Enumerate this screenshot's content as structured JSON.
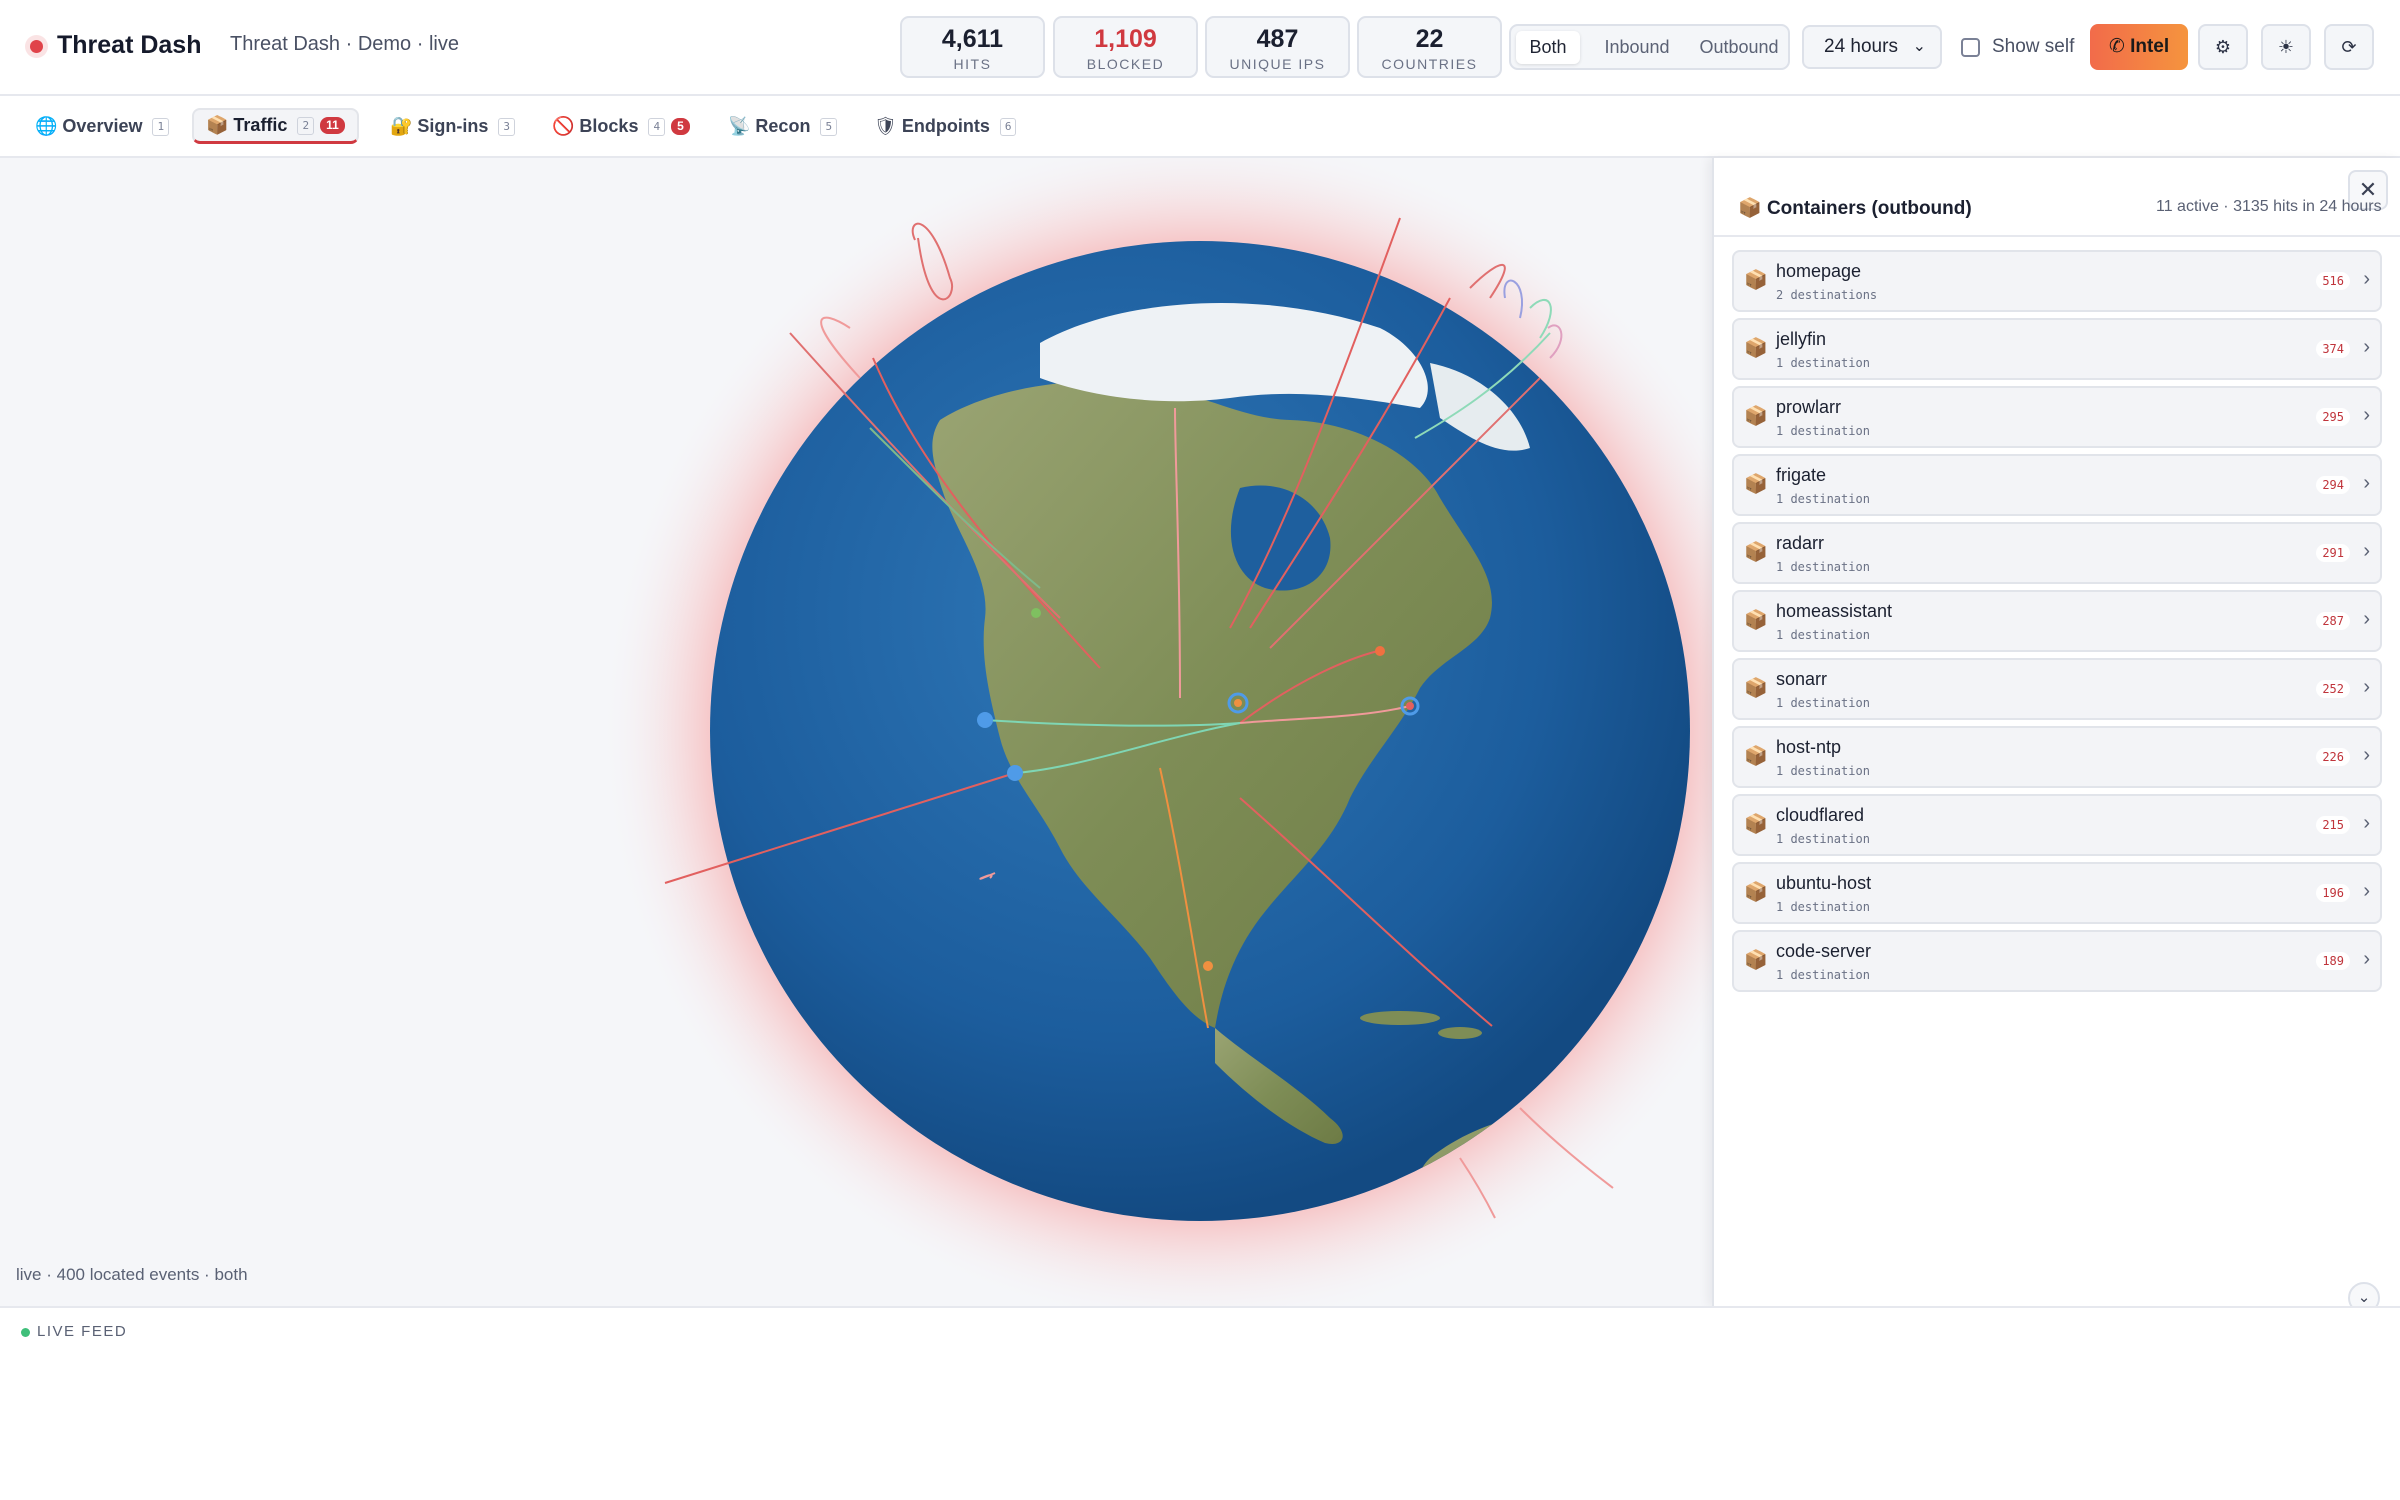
{
  "header": {
    "title": "Threat Dash",
    "subtitle": "Threat Dash · Demo · live"
  },
  "stats": [
    {
      "value": "4,611",
      "label": "HITS"
    },
    {
      "value": "1,109",
      "label": "BLOCKED"
    },
    {
      "value": "487",
      "label": "UNIQUE IPS"
    },
    {
      "value": "22",
      "label": "COUNTRIES"
    }
  ],
  "direction": {
    "options": [
      "Both",
      "Inbound",
      "Outbound"
    ],
    "selected": "Both"
  },
  "time_range": {
    "value": "24 hours"
  },
  "show_self": {
    "label": "Show self",
    "checked": false
  },
  "intel": {
    "label": "Intel"
  },
  "header_icons": [
    "gear-icon",
    "sun-icon",
    "refresh-icon"
  ],
  "tabs": [
    {
      "icon": "🌐",
      "label": "Overview",
      "key": "1",
      "badge": ""
    },
    {
      "icon": "📦",
      "label": "Traffic",
      "key": "2",
      "badge": "11"
    },
    {
      "icon": "🔐",
      "label": "Sign-ins",
      "key": "3",
      "badge": ""
    },
    {
      "icon": "🚫",
      "label": "Blocks",
      "key": "4",
      "badge": "5"
    },
    {
      "icon": "📡",
      "label": "Recon",
      "key": "5",
      "badge": ""
    },
    {
      "icon": "🛡",
      "label": "Endpoints",
      "key": "6",
      "badge": ""
    }
  ],
  "active_tab": "Traffic",
  "map": {
    "status": "live · 400 located events · both"
  },
  "panel": {
    "icon": "📦",
    "title": "Containers (outbound)",
    "meta": "11 active · 3135 hits in 24 hours",
    "rows": [
      {
        "name": "homepage",
        "sub": "2 destinations",
        "count": "516"
      },
      {
        "name": "jellyfin",
        "sub": "1 destination",
        "count": "374"
      },
      {
        "name": "prowlarr",
        "sub": "1 destination",
        "count": "295"
      },
      {
        "name": "frigate",
        "sub": "1 destination",
        "count": "294"
      },
      {
        "name": "radarr",
        "sub": "1 destination",
        "count": "291"
      },
      {
        "name": "homeassistant",
        "sub": "1 destination",
        "count": "287"
      },
      {
        "name": "sonarr",
        "sub": "1 destination",
        "count": "252"
      },
      {
        "name": "host-ntp",
        "sub": "1 destination",
        "count": "226"
      },
      {
        "name": "cloudflared",
        "sub": "1 destination",
        "count": "215"
      },
      {
        "name": "ubuntu-host",
        "sub": "1 destination",
        "count": "196"
      },
      {
        "name": "code-server",
        "sub": "1 destination",
        "count": "189"
      }
    ]
  },
  "feed": {
    "label": "LIVE FEED"
  },
  "colors": {
    "accent_red": "#d03940",
    "intel_gradient_start": "#f26b4a",
    "intel_gradient_end": "#f5943e",
    "ocean": "#1f5e9c",
    "land": "#7c8c55",
    "live_green": "#3fbf7a"
  }
}
